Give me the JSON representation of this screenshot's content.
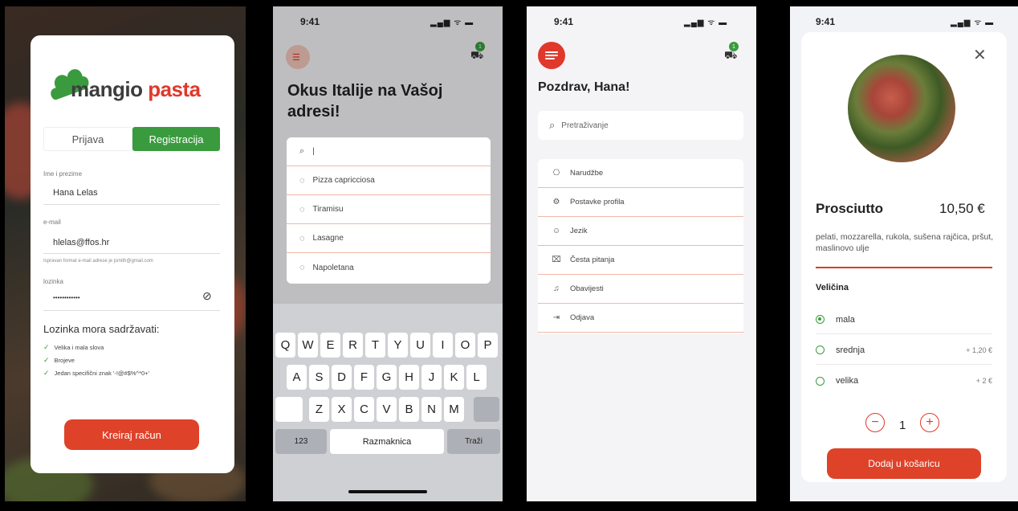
{
  "status_bar": {
    "time": "9:41",
    "icons": "▂▄▆ ᯤ ▬"
  },
  "screen1": {
    "logo": {
      "word1": "mangio",
      "word2": "pasta"
    },
    "tabs": [
      "Prijava",
      "Registracija"
    ],
    "fields": {
      "name_label": "Ime i prezime",
      "name_value": "Hana Lelas",
      "email_label": "e-mail",
      "email_value": "hlelas@ffos.hr",
      "email_hint": "Ispravan format e-mail adrese je jsmith@gmail.com",
      "password_label": "lozinka",
      "password_value": "••••••••••••"
    },
    "password_rules_title": "Lozinka mora sadržavati:",
    "password_rules": [
      "Velika i mala slova",
      "Brojeve",
      "Jedan specifični znak '-!@#$%^*0+'"
    ],
    "submit_label": "Kreiraj račun"
  },
  "screen2": {
    "heading": "Okus Italije na Vašoj adresi!",
    "cart_count": "1",
    "search_value": "|",
    "suggestions": [
      "Pizza capricciosa",
      "Tiramisu",
      "Lasagne",
      "Napoletana"
    ],
    "keyboard": {
      "row1": [
        "Q",
        "W",
        "E",
        "R",
        "T",
        "Y",
        "U",
        "I",
        "O",
        "P"
      ],
      "row2": [
        "A",
        "S",
        "D",
        "F",
        "G",
        "H",
        "J",
        "K",
        "L"
      ],
      "row3": [
        "Z",
        "X",
        "C",
        "V",
        "B",
        "N",
        "M"
      ],
      "numbers": "123",
      "space": "Razmaknica",
      "action": "Traži"
    }
  },
  "screen3": {
    "greeting": "Pozdrav, Hana!",
    "cart_count": "1",
    "search_placeholder": "Pretraživanje",
    "menu": [
      {
        "label": "Narudžbe",
        "icon": "⎔"
      },
      {
        "label": "Postavke profila",
        "icon": "⚙"
      },
      {
        "label": "Jezik",
        "icon": "☺"
      },
      {
        "label": "Česta pitanja",
        "icon": "⌧"
      },
      {
        "label": "Obavijesti",
        "icon": "♫"
      },
      {
        "label": "Odjava",
        "icon": "⇥"
      }
    ]
  },
  "screen4": {
    "product_name": "Prosciutto",
    "price": "10,50 €",
    "description": "pelati, mozzarella, rukola, sušena rajčica, pršut, maslinovo ulje",
    "size_title": "Veličina",
    "sizes": [
      {
        "label": "mala",
        "extra": ""
      },
      {
        "label": "srednja",
        "extra": "+ 1,20 €"
      },
      {
        "label": "velika",
        "extra": "+ 2 €"
      }
    ],
    "quantity": "1",
    "add_label": "Dodaj u košaricu"
  },
  "colors": {
    "accent_red": "#de4229",
    "green": "#3a9b3e"
  }
}
